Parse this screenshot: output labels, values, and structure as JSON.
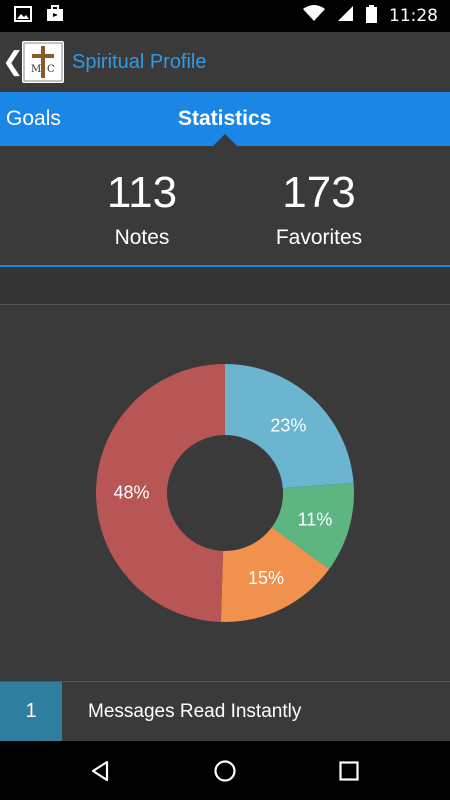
{
  "status_bar": {
    "time": "11:28",
    "left_icons": [
      "image-icon",
      "briefcase-icon"
    ],
    "right_icons": [
      "wifi-icon",
      "signal-icon",
      "battery-icon"
    ]
  },
  "app_bar": {
    "title": "Spiritual Profile",
    "logo_text": "MTC",
    "back_icon": "chevron-left-icon"
  },
  "tabs": [
    {
      "label": "Goals",
      "selected": false
    },
    {
      "label": "Statistics",
      "selected": true
    }
  ],
  "stats": {
    "notes": {
      "value": "113",
      "label": "Notes"
    },
    "favorites": {
      "value": "173",
      "label": "Favorites"
    }
  },
  "chart_data": {
    "type": "pie",
    "donut": true,
    "title": "",
    "slices": [
      {
        "label": "23%",
        "value": 23,
        "color": "#6bb5d0"
      },
      {
        "label": "11%",
        "value": 11,
        "color": "#5db582"
      },
      {
        "label": "15%",
        "value": 15,
        "color": "#f0914e"
      },
      {
        "label": "48%",
        "value": 48,
        "color": "#b85656"
      }
    ]
  },
  "list": [
    {
      "count": "1",
      "label": "Messages Read Instantly"
    }
  ],
  "nav_bar": {
    "buttons": [
      "back-icon",
      "home-icon",
      "recents-icon"
    ]
  },
  "colors": {
    "accent": "#1a87e6",
    "title_blue": "#2d9be8",
    "background": "#3a3a3a",
    "badge": "#2e7fa0"
  }
}
